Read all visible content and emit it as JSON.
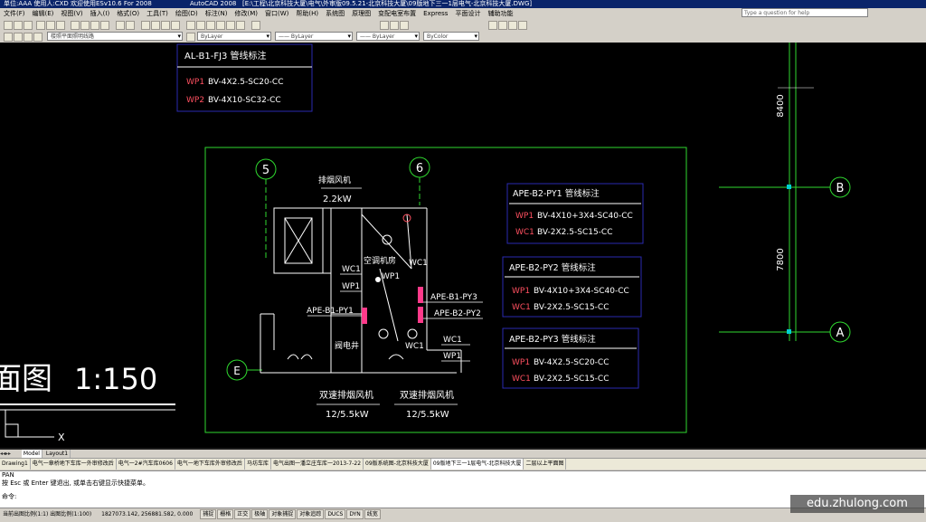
{
  "titlebar": {
    "left_text": "单位:AAA  使用人:CXD  欢迎使用ESv10.6 For 2008",
    "app": "AutoCAD 2008",
    "path": "[E:\\工程\\北京科技大厦\\电气\\外审版09.5.21-北京科技大厦\\09版地下三一1层电气-北京科技大厦.DWG]"
  },
  "menubar": {
    "items": [
      "文件(F)",
      "编辑(E)",
      "视图(V)",
      "插入(I)",
      "格式(O)",
      "工具(T)",
      "绘图(D)",
      "标注(N)",
      "修改(M)",
      "窗口(W)",
      "帮助(H)",
      "系统图",
      "原理图",
      "变配电室布置",
      "Express",
      "平面设计",
      "辅助功能"
    ],
    "help_placeholder": "Type a question for help"
  },
  "toolbar": {
    "layer_filter": "楼照平面照明线路",
    "color": "ByLayer",
    "linetype": "—— ByLayer",
    "lineweight": "—— ByLayer",
    "plotstyle": "ByColor"
  },
  "drawing": {
    "fj3_title": "AL-B1-FJ3  管线标注",
    "fj3_rows": [
      {
        "code": "WP1",
        "spec": "BV-4X2.5-SC20-CC"
      },
      {
        "code": "WP2",
        "spec": "BV-4X10-SC32-CC"
      }
    ],
    "py1_title": "APE-B2-PY1 管线标注",
    "py1_rows": [
      {
        "code": "WP1",
        "spec": "BV-4X10+3X4-SC40-CC"
      },
      {
        "code": "WC1",
        "spec": "BV-2X2.5-SC15-CC"
      }
    ],
    "py2_title": "APE-B2-PY2 管线标注",
    "py2_rows": [
      {
        "code": "WP1",
        "spec": "BV-4X10+3X4-SC40-CC"
      },
      {
        "code": "WC1",
        "spec": "BV-2X2.5-SC15-CC"
      }
    ],
    "py3_title": "APE-B2-PY3 管线标注",
    "py3_rows": [
      {
        "code": "WP1",
        "spec": "BV-4X2.5-SC20-CC"
      },
      {
        "code": "WC1",
        "spec": "BV-2X2.5-SC15-CC"
      }
    ],
    "axis_5": "5",
    "axis_6": "6",
    "axis_E": "E",
    "axis_B": "B",
    "axis_A": "A",
    "dim_8400": "8400",
    "dim_7800": "7800",
    "fan_label": "排烟风机",
    "fan_power": "2.2kW",
    "room_ac": "空调机房",
    "room_pipe": "阀电井",
    "label_wc1_a": "WC1",
    "label_wp1_a": "WP1",
    "label_wc1_b": "WC1",
    "label_wp1_b": "WP1",
    "label_wc1_c": "WC1",
    "label_wc1_d": "WC1",
    "label_wp1_d": "WP1",
    "label_py1": "APE-B1-PY1",
    "label_py3": "APE-B1-PY3",
    "label_py2": "APE-B2-PY2",
    "dual_fan_1": "双速排烟风机",
    "dual_fan_1_power": "12/5.5kW",
    "dual_fan_2": "双速排烟风机",
    "dual_fan_2_power": "12/5.5kW",
    "scale_title": "面图",
    "scale": "1:150",
    "ucs_x": "X"
  },
  "layout_tabs": [
    "Model",
    "Layout1"
  ],
  "file_tabs": [
    "Drawing1",
    "电气一章桥地下车库一外审修改后",
    "电气一2#汽车库0606",
    "电气一地下车库外审修改后",
    "马坊车库",
    "电气出图一潘立庄车库一2013-7-22",
    "09版系统图-北京科技大厦",
    "09版地下三一1层电气-北京科技大厦",
    "二层以上平面图"
  ],
  "command": {
    "line1": "PAN",
    "line2": "按 Esc 或 Enter 键退出, 或单击右键显示快捷菜单。",
    "prompt": "命令:"
  },
  "status": {
    "scale": "当前出图比例(1:1) 出图比例(1:100)",
    "coords": "1827073.142, 256881.582, 0.000",
    "buttons": [
      "捕捉",
      "栅格",
      "正交",
      "极轴",
      "对象捕捉",
      "对象追踪",
      "DUCS",
      "DYN",
      "线宽"
    ]
  },
  "watermark": "edu.zhulong.com",
  "colors": {
    "green": "#2fd82f",
    "white": "#ffffff",
    "red": "#ff5060",
    "pink": "#ff3a8a",
    "blue": "#2a2ab0",
    "cyan": "#00d0d0"
  }
}
